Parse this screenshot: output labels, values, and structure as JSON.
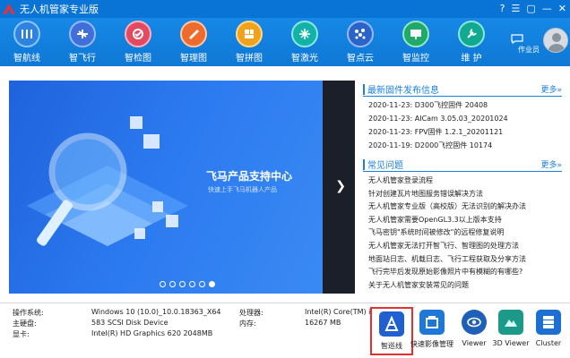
{
  "app": {
    "title": "无人机管家专业版"
  },
  "toolbar": {
    "items": [
      {
        "label": "智航线",
        "icon": "route-icon",
        "color": "#2e83e0"
      },
      {
        "label": "智飞行",
        "icon": "drone-icon",
        "color": "#3f6fd8"
      },
      {
        "label": "智检图",
        "icon": "check-image-icon",
        "color": "#e34a60"
      },
      {
        "label": "智理图",
        "icon": "manage-image-icon",
        "color": "#ef6b2d"
      },
      {
        "label": "智拼图",
        "icon": "puzzle-icon",
        "color": "#f0a21c"
      },
      {
        "label": "智激光",
        "icon": "laser-icon",
        "color": "#13b2a7"
      },
      {
        "label": "智点云",
        "icon": "point-cloud-icon",
        "color": "#2b64c9"
      },
      {
        "label": "智监控",
        "icon": "monitor-icon",
        "color": "#1fa96a"
      },
      {
        "label": "维  护",
        "icon": "maintenance-icon",
        "color": "#11a98f"
      }
    ],
    "user_label": "作业员"
  },
  "banner": {
    "title": "飞马产品支持中心",
    "subtitle": "快速上手飞马机器人产品",
    "slides": 6,
    "active_slide": 6
  },
  "news": {
    "title": "最新固件发布信息",
    "more": "更多»",
    "items": [
      "2020-11-23: D300飞控固件 20408",
      "2020-11-23: AICam 3.05.03_20201024",
      "2020-11-23: FPV固件 1.2.1_20201121",
      "2020-11-19: D2000飞控固件 10174"
    ]
  },
  "faq": {
    "title": "常见问题",
    "more": "更多»",
    "items": [
      "无人机管家登录流程",
      "针对创建瓦片地图服务错误解决方法",
      "无人机管家专业版（高校版）无法识别的解决办法",
      "无人机管家需要OpenGL3.3以上版本支持",
      "飞马密钥\"系统时间被修改\"的远程修复说明",
      "无人机管家无法打开智飞行、智理图的处理方法",
      "地面站日志、机载日志、飞行工程获取及分享方法",
      "飞行完毕后发现原始影像照片中有模糊的有哪些?",
      "关于无人机管家安装常见的问题"
    ]
  },
  "sysinfo": {
    "os_label": "操作系统:",
    "os_value": "Windows 10 (10.0)_10.0.18363_X64",
    "disk_label": "主硬盘:",
    "disk_value": "583  SCSI Disk Device",
    "gpu_label": "显卡:",
    "gpu_value": "Intel(R) HD Graphics 620 2048MB",
    "cpu_label": "处理器:",
    "cpu_value": "Intel(R) Core(TM) i",
    "mem_label": "内存:",
    "mem_value": "16267 MB"
  },
  "launchers": [
    {
      "label": "智巡线",
      "icon": "patrol-line-icon",
      "color": "#1f5fd0",
      "selected": true
    },
    {
      "label": "快速影像管理",
      "icon": "image-manager-icon",
      "color": "#1e78d8"
    },
    {
      "label": "Viewer",
      "icon": "eye-icon",
      "color": "#1e60b8"
    },
    {
      "label": "3D Viewer",
      "icon": "terrain-icon",
      "color": "#1b9a8a"
    },
    {
      "label": "Cluster",
      "icon": "server-icon",
      "color": "#1d6fd2"
    }
  ]
}
